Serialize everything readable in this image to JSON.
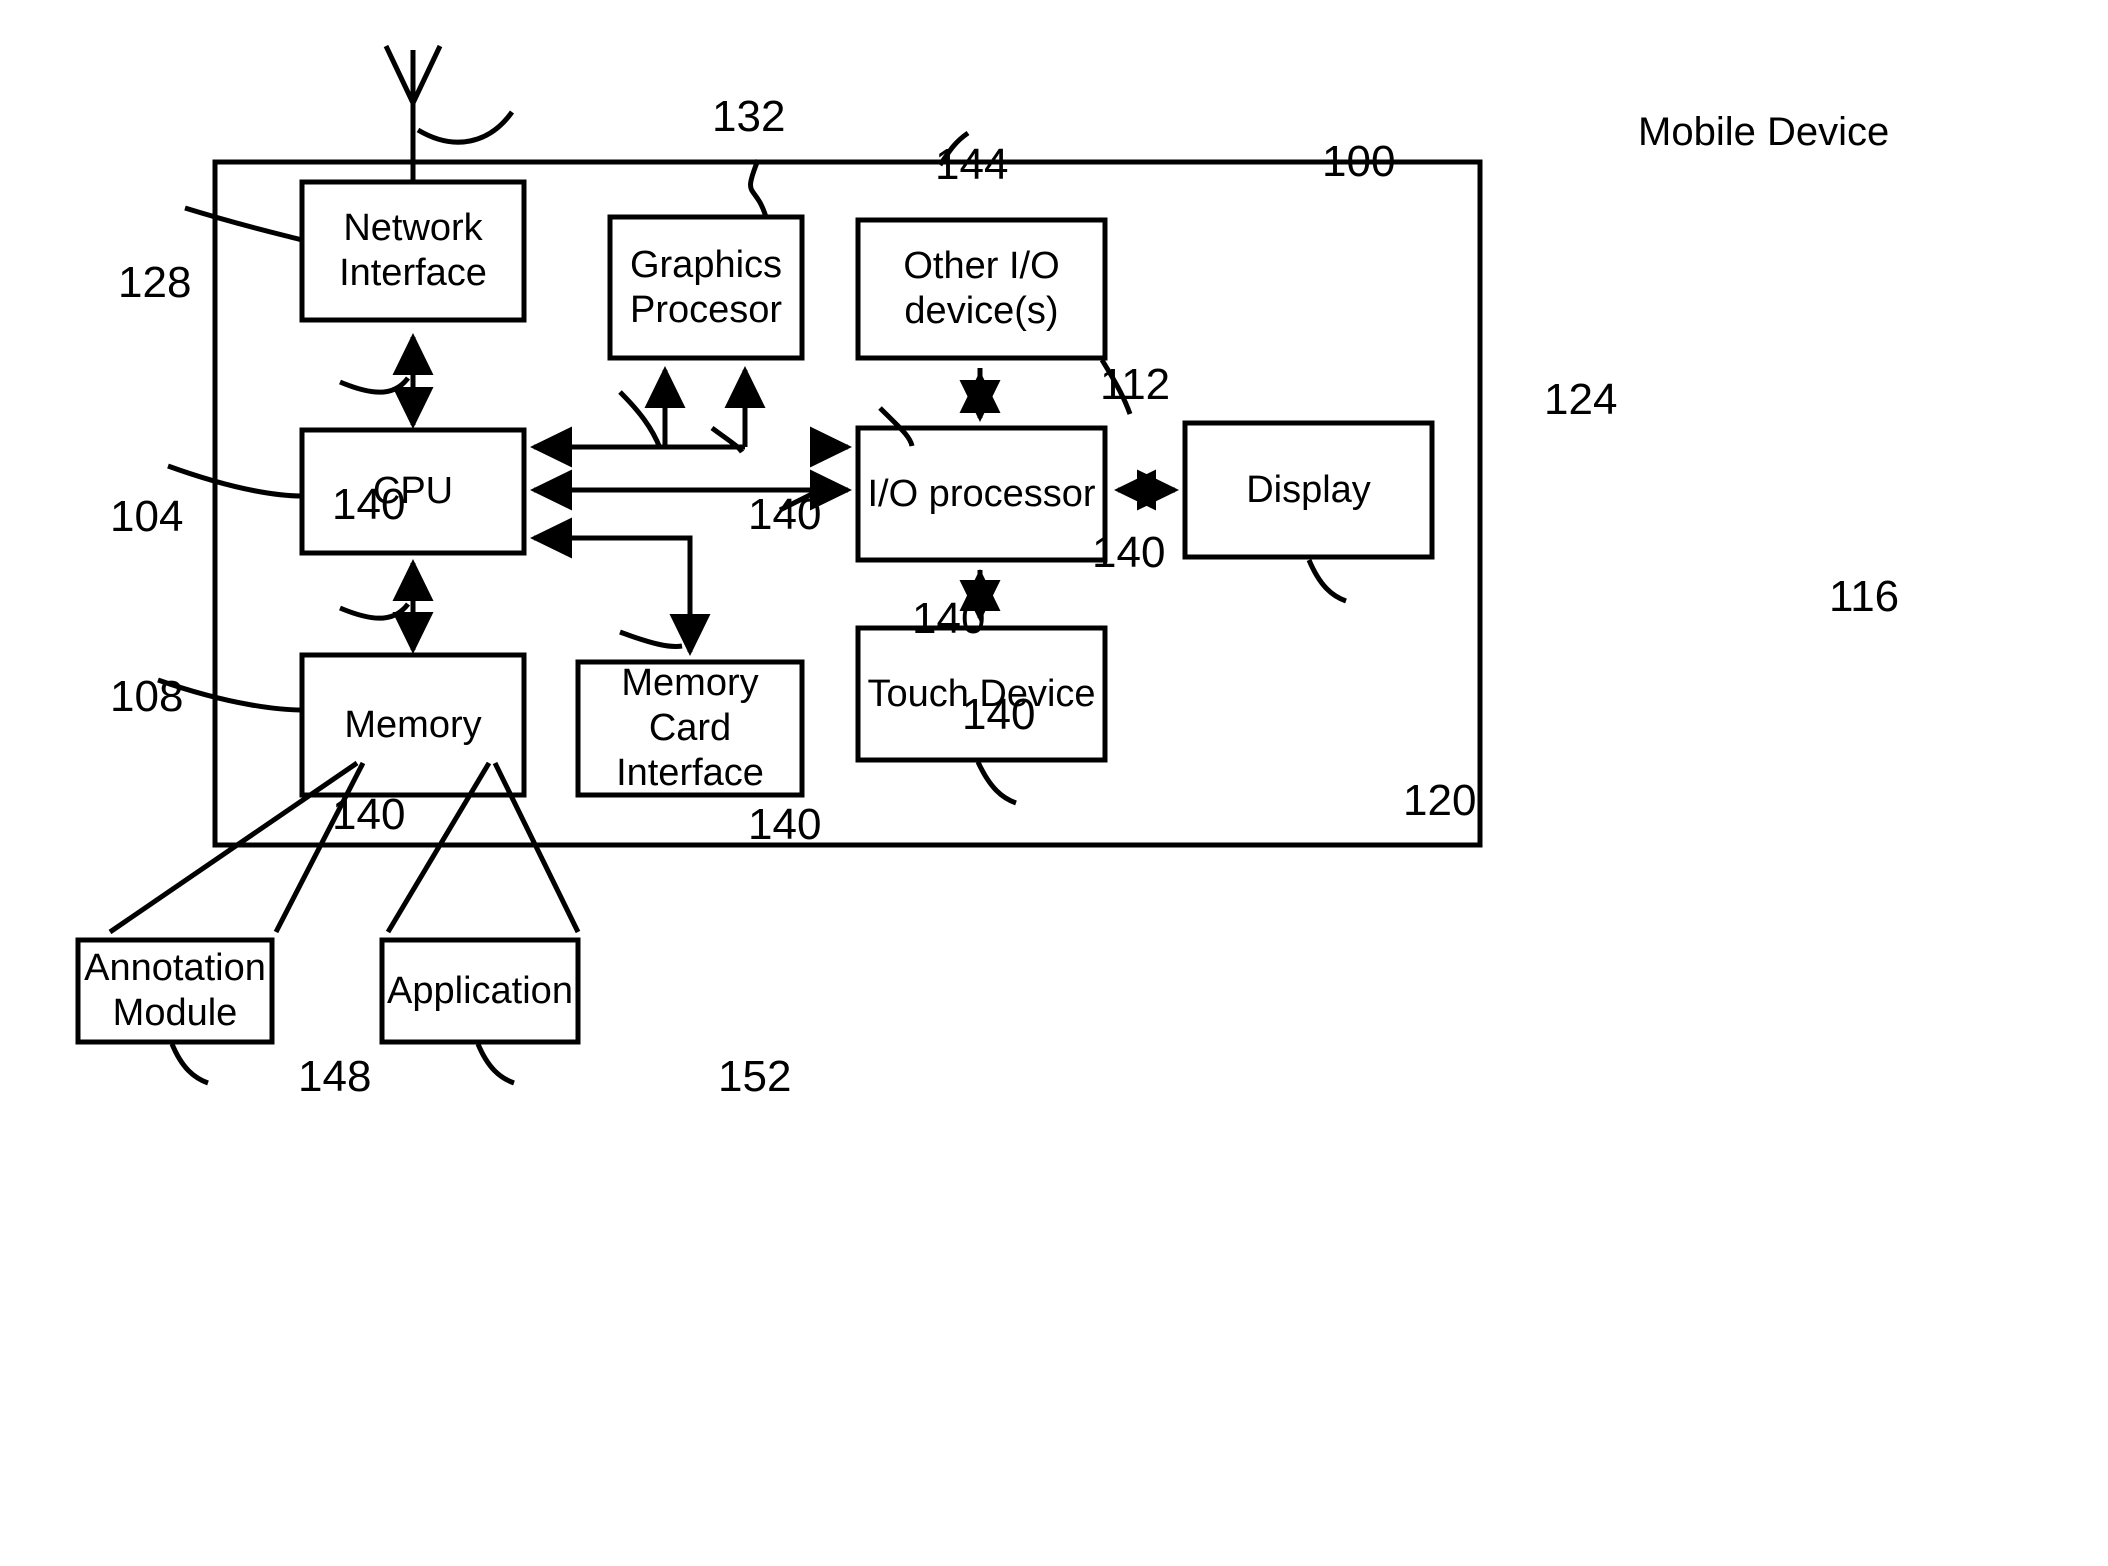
{
  "figure": {
    "type": "patent-block-diagram",
    "outer_label": "Mobile Device",
    "outer_ref": "100"
  },
  "blocks": [
    {
      "id": "network-interface",
      "label": "Network\nInterface",
      "ref": "128"
    },
    {
      "id": "graphics-processor",
      "label": "Graphics\nProcesor",
      "ref": "144"
    },
    {
      "id": "other-io-devices",
      "label": "Other I/O\ndevice(s)",
      "ref": "124"
    },
    {
      "id": "cpu",
      "label": "CPU",
      "ref": "104"
    },
    {
      "id": "io-processor",
      "label": "I/O processor",
      "ref": "112"
    },
    {
      "id": "display",
      "label": "Display",
      "ref": "116"
    },
    {
      "id": "memory",
      "label": "Memory",
      "ref": "108"
    },
    {
      "id": "memory-card-interface",
      "label": "Memory Card\nInterface",
      "ref": "140"
    },
    {
      "id": "touch-device",
      "label": "Touch Device",
      "ref": "120"
    },
    {
      "id": "annotation-module",
      "label": "Annotation\nModule",
      "ref": "148"
    },
    {
      "id": "application",
      "label": "Application",
      "ref": "152"
    }
  ],
  "antenna": {
    "ref": "132"
  },
  "bus_refs": [
    {
      "id": "bus-ni-cpu",
      "value": "140"
    },
    {
      "id": "bus-cpu-gpu-left",
      "value": "140"
    },
    {
      "id": "bus-cpu-gpu-right",
      "value": "140"
    },
    {
      "id": "bus-cpu-io-upper",
      "value": "140"
    },
    {
      "id": "bus-cpu-io-mid",
      "value": "140"
    },
    {
      "id": "bus-cpu-memory",
      "value": "140"
    },
    {
      "id": "bus-memcard-cpu",
      "value": "140"
    }
  ],
  "colors": {
    "stroke": "#000000",
    "background": "#ffffff"
  }
}
